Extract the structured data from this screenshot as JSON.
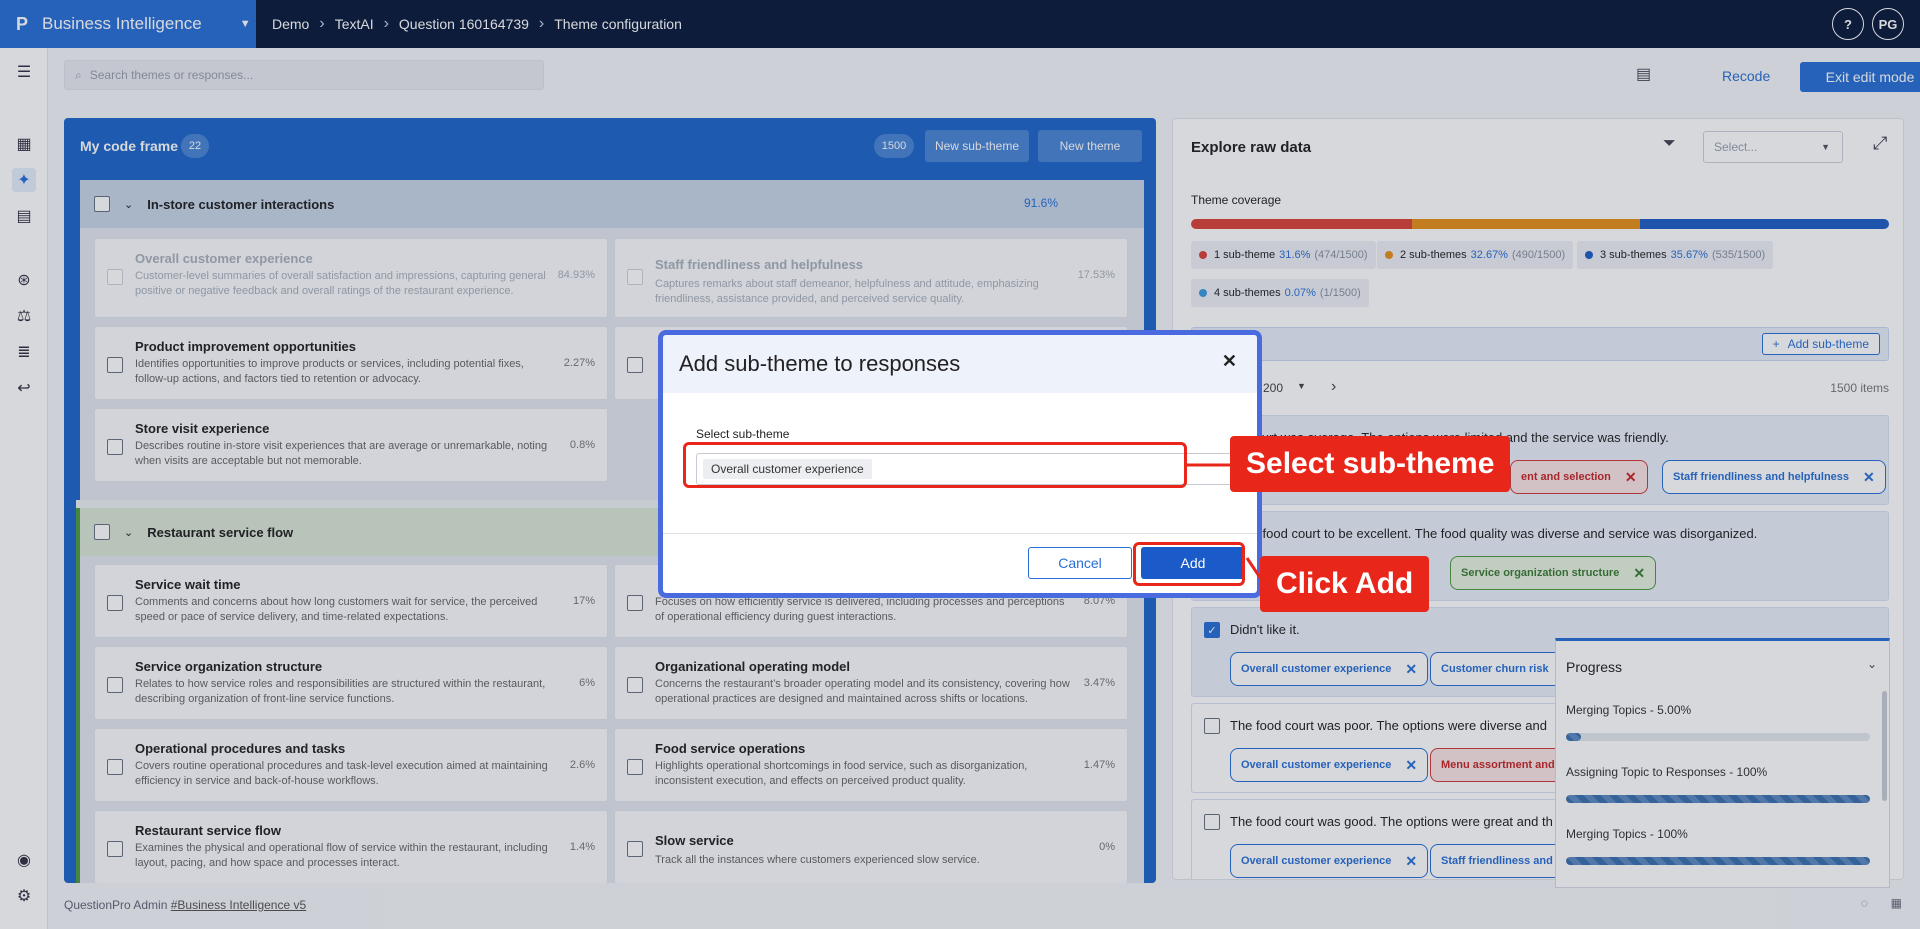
{
  "topbar": {
    "brand": "Business Intelligence",
    "breadcrumbs": [
      "Demo",
      "TextAI",
      "Question 160164739",
      "Theme configuration"
    ],
    "help": "?",
    "avatar": "PG"
  },
  "toolbar": {
    "search_placeholder": "Search themes or responses...",
    "recode": "Recode",
    "exit_edit": "Exit edit mode"
  },
  "codeframe": {
    "title": "My code frame",
    "count": "22",
    "responses": "1500",
    "new_subtheme": "New sub-theme",
    "new_theme": "New theme"
  },
  "groups": [
    {
      "title": "In-store customer interactions",
      "pct": "91.6%",
      "cards": [
        {
          "title": "Overall customer experience",
          "desc": "Customer-level summaries of overall satisfaction and impressions, capturing general positive or negative feedback and overall ratings of the restaurant experience.",
          "pct": "84.93%"
        },
        {
          "title": "Staff friendliness and helpfulness",
          "desc": "Captures remarks about staff demeanor, helpfulness and attitude, emphasizing friendliness, assistance provided, and perceived service quality.",
          "pct": "17.53%"
        },
        {
          "title": "Product improvement opportunities",
          "desc": "Identifies opportunities to improve products or services, including potential fixes, follow-up actions, and factors tied to retention or advocacy.",
          "pct": "2.27%"
        },
        {
          "title": "Store visit experience",
          "desc": "Describes routine in-store visit experiences that are average or unremarkable, noting when visits are acceptable but not memorable.",
          "pct": "0.8%"
        }
      ]
    },
    {
      "title": "Restaurant service flow",
      "cards": [
        {
          "title": "Service wait time",
          "desc": "Comments and concerns about how long customers wait for service, the perceived speed or pace of service delivery, and time-related expectations.",
          "pct": "17%"
        },
        {
          "title": "",
          "desc": "Focuses on how efficiently service is delivered, including processes and perceptions of operational efficiency during guest interactions.",
          "pct": "8.07%"
        },
        {
          "title": "Service organization structure",
          "desc": "Relates to how service roles and responsibilities are structured within the restaurant, describing organization of front-line service functions.",
          "pct": "6%"
        },
        {
          "title": "Organizational operating model",
          "desc": "Concerns the restaurant’s broader operating model and its consistency, covering how operational practices are designed and maintained across shifts or locations.",
          "pct": "3.47%"
        },
        {
          "title": "Operational procedures and tasks",
          "desc": "Covers routine operational procedures and task-level execution aimed at maintaining efficiency in service and back-of-house workflows.",
          "pct": "2.6%"
        },
        {
          "title": "Food service operations",
          "desc": "Highlights operational shortcomings in food service, such as disorganization, inconsistent execution, and effects on perceived product quality.",
          "pct": "1.47%"
        },
        {
          "title": "Restaurant service flow",
          "desc": "Examines the physical and operational flow of service within the restaurant, including layout, pacing, and how space and processes interact.",
          "pct": "1.4%"
        },
        {
          "title": "Slow service",
          "desc": "Track all the instances where customers experienced slow service.",
          "pct": "0%"
        }
      ]
    }
  ],
  "explore": {
    "title": "Explore raw data",
    "select_placeholder": "Select...",
    "coverage_label": "Theme coverage",
    "coverage": [
      {
        "label": "1 sub-theme",
        "pct": "31.6%",
        "count": "(474/1500)",
        "value": 31.6,
        "color": "#d9433b"
      },
      {
        "label": "2 sub-themes",
        "pct": "32.67%",
        "count": "(490/1500)",
        "value": 32.67,
        "color": "#e8901c"
      },
      {
        "label": "3 sub-themes",
        "pct": "35.67%",
        "count": "(535/1500)",
        "value": 35.67,
        "color": "#1f5fc4"
      },
      {
        "label": "4 sub-themes",
        "pct": "0.07%",
        "count": "(1/1500)",
        "value": 0.07,
        "color": "#3b9be0"
      }
    ],
    "add_subtheme": "Add sub-theme",
    "page_size": "200",
    "items": "1500 items",
    "responses": [
      {
        "text": "od court was average. The options were limited and the service was friendly.",
        "tags": [
          "ent and selection",
          "Staff friendliness and helpfulness"
        ]
      },
      {
        "text": "d the food court to be excellent. The food quality was diverse and service was disorganized.",
        "tags": [
          "Service organization structure"
        ]
      },
      {
        "text": "Didn't like it.",
        "tags": [
          "Overall customer experience",
          "Customer churn risk"
        ]
      },
      {
        "text": "The food court was poor. The options were diverse and",
        "tags": [
          "Overall customer experience",
          "Menu assortment and s"
        ]
      },
      {
        "text": "The food court was good. The options were great and th",
        "tags": [
          "Overall customer experience",
          "Staff friendliness and h"
        ]
      }
    ]
  },
  "progress": {
    "title": "Progress",
    "items": [
      {
        "label": "Merging Topics - 5.00%",
        "value": 5
      },
      {
        "label": "Assigning Topic to Responses - 100%",
        "value": 100
      },
      {
        "label": "Merging Topics - 100%",
        "value": 100
      }
    ]
  },
  "modal": {
    "title": "Add sub-theme to responses",
    "close": "✕",
    "label": "Select sub-theme",
    "selected": "Overall customer experience",
    "cancel": "Cancel",
    "add": "Add"
  },
  "callouts": {
    "select": "Select sub-theme",
    "add": "Click Add"
  },
  "footer": {
    "text": "QuestionPro Admin ",
    "link": "#Business Intelligence v5"
  }
}
